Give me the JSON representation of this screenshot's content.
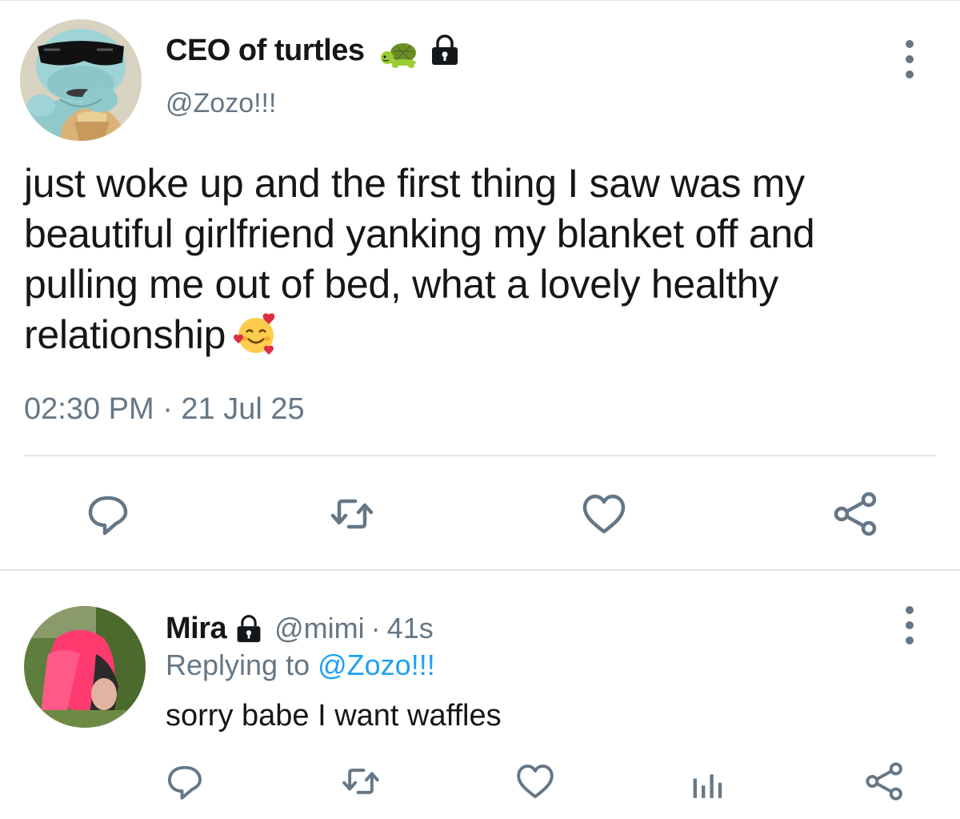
{
  "main_tweet": {
    "display_name": "CEO of turtles",
    "name_emoji": "turtle-emoji",
    "handle": "@Zozo!!!",
    "text_lines": [
      "just woke up and the first thing I saw was my",
      "beautiful girlfriend yanking my blanket off and",
      "pulling me out of bed, what a lovely healthy",
      "relationship"
    ],
    "text_emoji": "smiling-face-with-hearts-emoji",
    "timestamp": "02:30 PM · 21 Jul 25",
    "actions": [
      "comment-icon",
      "retweet-icon",
      "heart-icon",
      "share-icon"
    ]
  },
  "reply": {
    "display_name": "Mira",
    "handle": "@mimi",
    "separator": "·",
    "time": "41s",
    "replying_prefix": "Replying to ",
    "replying_to": "@Zozo!!!",
    "text": "sorry babe I want waffles",
    "actions": [
      "comment-icon",
      "retweet-icon",
      "heart-icon",
      "analytics-icon",
      "share-icon"
    ]
  },
  "colors": {
    "text_primary": "#14171a",
    "text_secondary": "#657786",
    "link": "#1da1f2",
    "divider": "#e1e8ed"
  }
}
